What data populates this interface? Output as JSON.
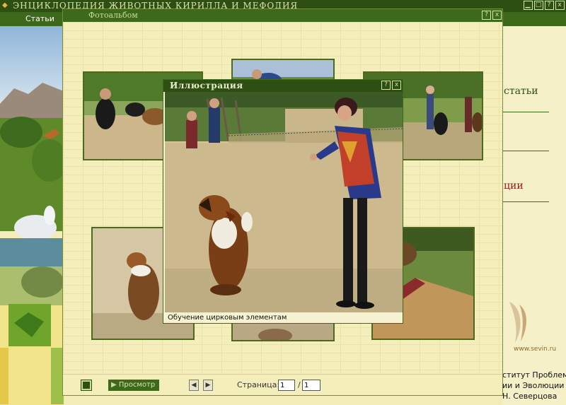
{
  "app": {
    "title": "ЭНЦИКЛОПЕДИЯ ЖИВОТНЫХ КИРИЛЛА И МЕФОДИЯ",
    "menu_item": "Статьи",
    "help_glyph": "?",
    "close_glyph": "x"
  },
  "right_panel": {
    "articles_fragment": "статьи",
    "red_fragment": "ции",
    "site": "www.sevin.ru",
    "institute_lines": [
      "ститут Проблем",
      "ии и Эволюции",
      "Н. Северцова"
    ]
  },
  "album": {
    "title": "Фотоальбом",
    "help_glyph": "?",
    "close_glyph": "x",
    "view_button": "Просмотр",
    "page_label": "Страница:",
    "page_current": "1",
    "page_separator": "/",
    "page_total": "1"
  },
  "illustration": {
    "title": "Иллюстрация",
    "help_glyph": "?",
    "close_glyph": "x",
    "caption": "Обучение цирковым элементам"
  },
  "colors": {
    "dark_green": "#2d4f12",
    "green": "#3d6a1a",
    "cream": "#f4efba",
    "brick_line": "#ece2a3",
    "accent_red": "#8b1a1a"
  }
}
